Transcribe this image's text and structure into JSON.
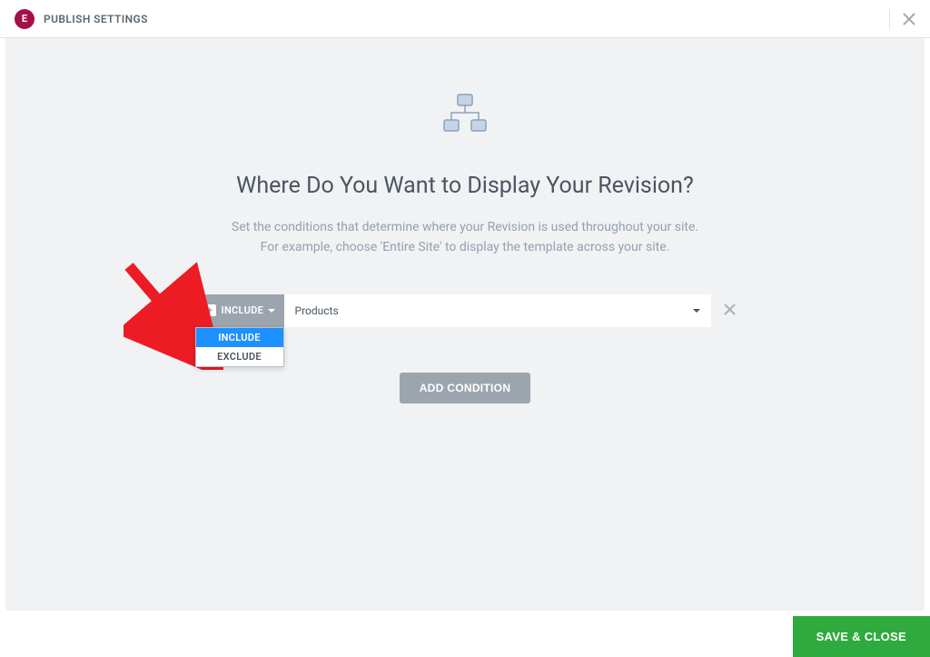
{
  "header": {
    "logo_text": "E",
    "title": "PUBLISH SETTINGS"
  },
  "main": {
    "heading": "Where Do You Want to Display Your Revision?",
    "subtext_line1": "Set the conditions that determine where your Revision is used throughout your site.",
    "subtext_line2": "For example, choose 'Entire Site' to display the template across your site.",
    "add_condition_label": "ADD CONDITION"
  },
  "condition": {
    "include_label": "INCLUDE",
    "location_value": "Products",
    "dropdown_options": {
      "include": "INCLUDE",
      "exclude": "EXCLUDE"
    }
  },
  "footer": {
    "save_label": "SAVE & CLOSE"
  }
}
